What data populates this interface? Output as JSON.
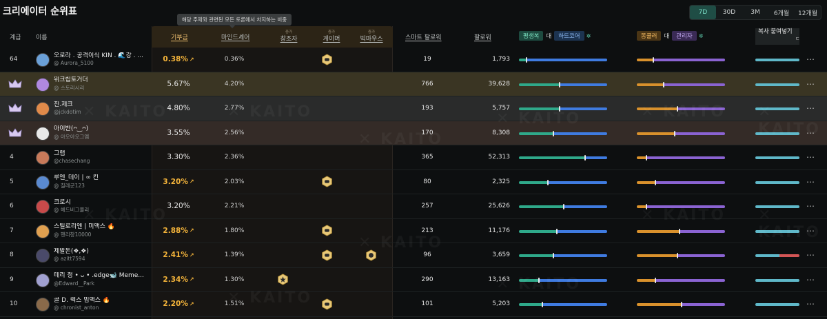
{
  "title": "크리에이터 순위표",
  "periods": [
    "7D",
    "30D",
    "3M",
    "6개월",
    "12개월"
  ],
  "active_period": "7D",
  "tooltip": "해당 주제와 관련된 모든 토론에서 차지하는 비중",
  "watermark": "KAITO",
  "headers": {
    "rank": "계급",
    "name": "이름",
    "share": "기부금",
    "mindshare": "마인드셰어",
    "creator_small": "증가",
    "creator": "창조자",
    "gamer_small": "증가",
    "gamer": "게이머",
    "bigmouth_small": "증가",
    "bigmouth": "빅마우스",
    "smart_followers": "스마트 팔로워",
    "followers": "팔로워",
    "compare1_left": "평생복",
    "compare1_mid": "대",
    "compare1_right": "하드코어",
    "compare2_left": "똥쿨러",
    "compare2_mid": "대",
    "compare2_right": "관리자",
    "compare3": "복사 붙여넣기",
    "extra": "ㄷ"
  },
  "colors": {
    "accent": "#f3b33a",
    "teal": "#2fa98a",
    "blue": "#3f7be0",
    "orange": "#d9912c",
    "purple": "#8a63d2",
    "cyan": "#5fb8c9",
    "red": "#d25555"
  },
  "rows": [
    {
      "rank": "64",
      "crown": false,
      "name": "오로라 . 공격이식 KIN . 🌊강 . ...",
      "handle": "@ Aurora_5100",
      "share": "0.38%",
      "hot": true,
      "mind": "0.36%",
      "creator": false,
      "gamer": true,
      "bigmouth": false,
      "smart": "19",
      "followers": "1,793",
      "b1": 0.08,
      "b2": 0.18,
      "b3": 0.5
    },
    {
      "rank": "",
      "crown": true,
      "name": "위크립토거더",
      "handle": "@ 스토리시리",
      "share": "5.67%",
      "hot": false,
      "mind": "4.20%",
      "creator": false,
      "gamer": false,
      "bigmouth": false,
      "smart": "766",
      "followers": "39,628",
      "b1": 0.45,
      "b2": 0.3,
      "b3": 0.5
    },
    {
      "rank": "",
      "crown": true,
      "name": "진.제크",
      "handle": "@jckdotim",
      "share": "4.80%",
      "hot": false,
      "mind": "2.77%",
      "creator": false,
      "gamer": false,
      "bigmouth": false,
      "smart": "193",
      "followers": "5,757",
      "b1": 0.45,
      "b2": 0.45,
      "b3": 0.5
    },
    {
      "rank": "",
      "crown": true,
      "name": "아이반(ᴖ‿ᴖ)",
      "handle": "@ 아오아오그엠",
      "share": "3.55%",
      "hot": false,
      "mind": "2.56%",
      "creator": false,
      "gamer": false,
      "bigmouth": false,
      "smart": "170",
      "followers": "8,308",
      "b1": 0.38,
      "b2": 0.42,
      "b3": 0.5
    },
    {
      "rank": "4",
      "crown": false,
      "name": "그랩",
      "handle": "@chasechang",
      "share": "3.30%",
      "hot": false,
      "mind": "2.36%",
      "creator": false,
      "gamer": false,
      "bigmouth": false,
      "smart": "365",
      "followers": "52,313",
      "b1": 0.74,
      "b2": 0.1,
      "b3": 0.5
    },
    {
      "rank": "5",
      "crown": false,
      "name": "루엔_데이 | ∞ 킨",
      "handle": "@ 칠레군123",
      "share": "3.20%",
      "hot": true,
      "mind": "2.03%",
      "creator": false,
      "gamer": true,
      "bigmouth": false,
      "smart": "80",
      "followers": "2,325",
      "b1": 0.32,
      "b2": 0.2,
      "b3": 0.5
    },
    {
      "rank": "6",
      "crown": false,
      "name": "크로시",
      "handle": "@ 헤드비그몰리",
      "share": "3.20%",
      "hot": false,
      "mind": "2.21%",
      "creator": false,
      "gamer": false,
      "bigmouth": false,
      "smart": "257",
      "followers": "25,626",
      "b1": 0.5,
      "b2": 0.1,
      "b3": 0.5
    },
    {
      "rank": "7",
      "crown": false,
      "name": "스틸로리엔 | 미액스 🔥",
      "handle": "@ 핸리창10000",
      "share": "2.88%",
      "hot": true,
      "mind": "1.80%",
      "creator": false,
      "gamer": true,
      "bigmouth": false,
      "smart": "213",
      "followers": "11,176",
      "b1": 0.42,
      "b2": 0.48,
      "b3": 0.5
    },
    {
      "rank": "8",
      "crown": false,
      "name": "제발돈(❖,❖)",
      "handle": "@ azitt7594",
      "share": "2.41%",
      "hot": true,
      "mind": "1.39%",
      "creator": false,
      "gamer": true,
      "bigmouth": true,
      "smart": "96",
      "followers": "3,659",
      "b1": 0.38,
      "b2": 0.45,
      "b3": 0.55
    },
    {
      "rank": "9",
      "crown": false,
      "name": "테리 정 • ᴗ • .edge🐋 Meme...",
      "handle": "@Edward__Park",
      "share": "2.34%",
      "hot": true,
      "mind": "1.30%",
      "creator": true,
      "gamer": false,
      "bigmouth": false,
      "smart": "290",
      "followers": "13,163",
      "b1": 0.22,
      "b2": 0.2,
      "b3": 0.5
    },
    {
      "rank": "10",
      "crown": false,
      "name": "골 D. 렉스 밈액스 🔥",
      "handle": "@ chronist_anton",
      "share": "2.20%",
      "hot": true,
      "mind": "1.51%",
      "creator": false,
      "gamer": true,
      "bigmouth": false,
      "smart": "101",
      "followers": "5,203",
      "b1": 0.26,
      "b2": 0.5,
      "b3": 0.5
    }
  ]
}
